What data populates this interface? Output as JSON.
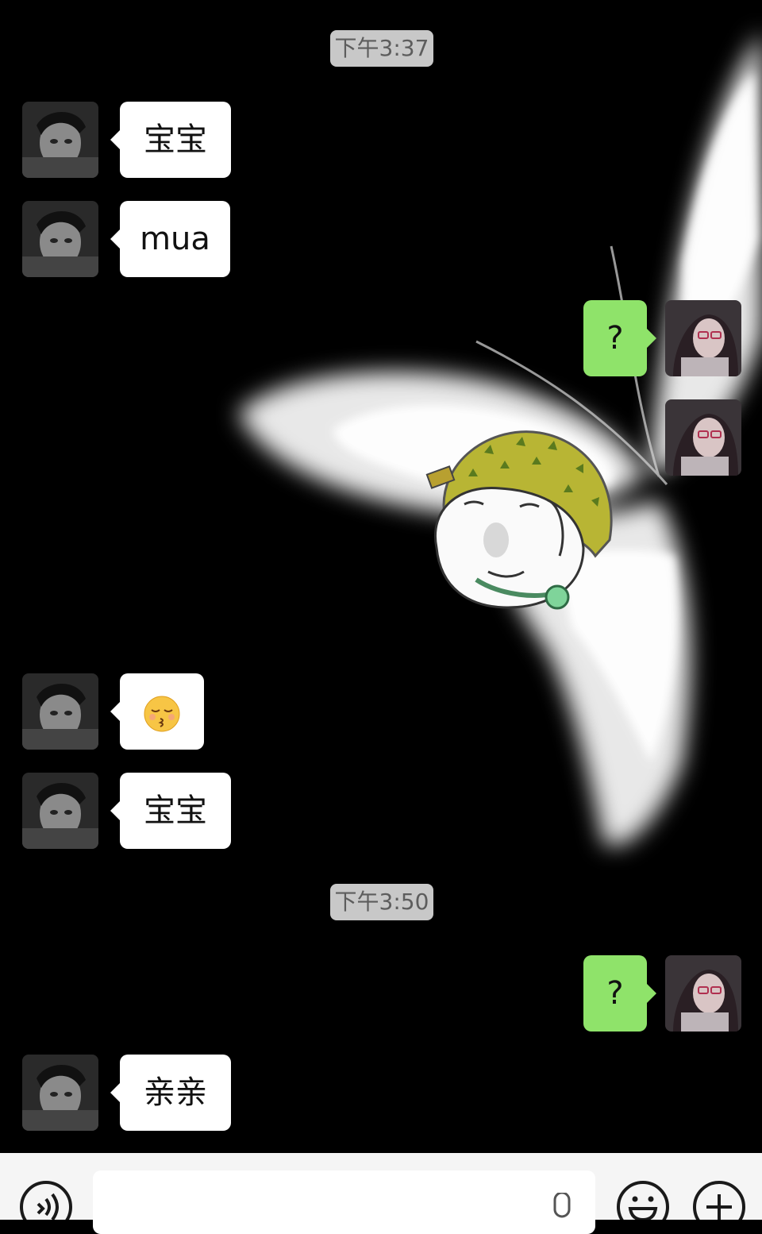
{
  "chat": {
    "timestamps": [
      "下午3:37",
      "下午3:50"
    ],
    "messages": [
      {
        "side": "in",
        "type": "text",
        "text": "宝宝"
      },
      {
        "side": "in",
        "type": "text",
        "text": "mua"
      },
      {
        "side": "out",
        "type": "text",
        "text": "?"
      },
      {
        "side": "out",
        "type": "sticker",
        "sticker": "durian-meme-sticker"
      },
      {
        "side": "in",
        "type": "emoji",
        "emoji": "kissing-face-emoji"
      },
      {
        "side": "in",
        "type": "text",
        "text": "宝宝"
      },
      {
        "side": "out",
        "type": "text",
        "text": "?"
      },
      {
        "side": "in",
        "type": "text",
        "text": "亲亲"
      }
    ]
  },
  "input_bar": {
    "value": "",
    "icons": [
      "voice-toggle-icon",
      "microphone-icon",
      "emoji-icon",
      "plus-icon"
    ]
  },
  "colors": {
    "outgoing_bubble": "#8fe36a",
    "incoming_bubble": "#ffffff",
    "timestamp_badge": "#c8c8c8",
    "input_bar": "#f5f5f5"
  }
}
